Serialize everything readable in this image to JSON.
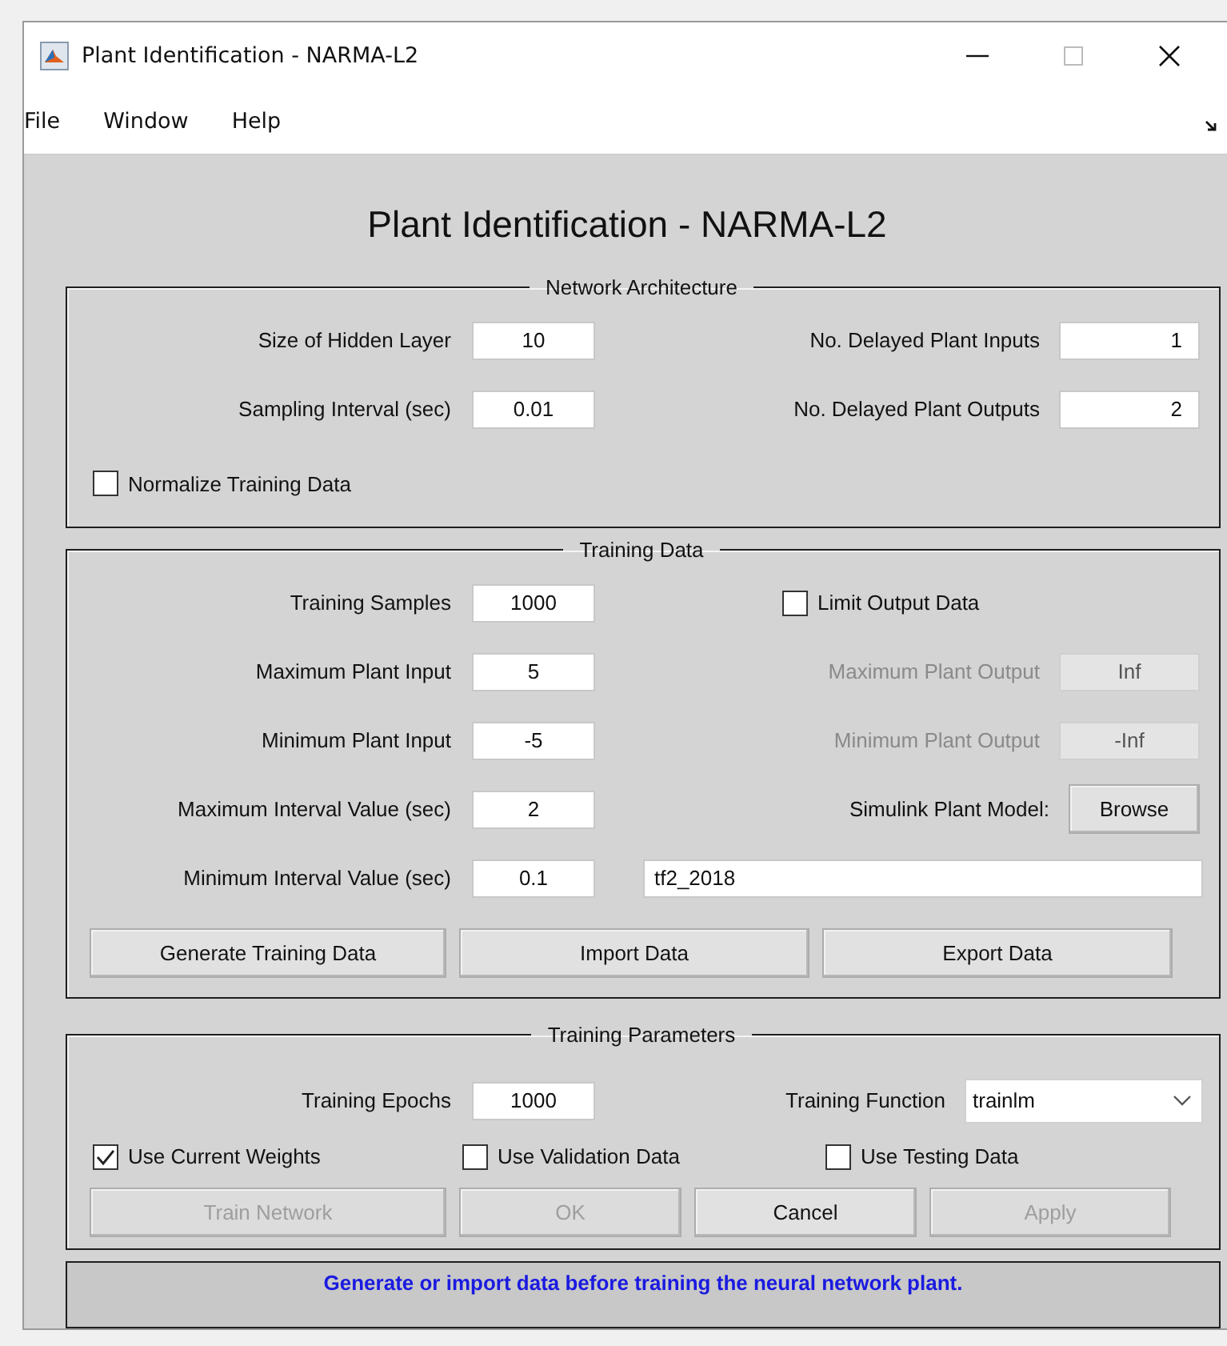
{
  "window": {
    "title": "Plant Identification - NARMA-L2"
  },
  "menu": [
    "File",
    "Window",
    "Help"
  ],
  "heading": "Plant Identification - NARMA-L2",
  "panels": [
    {
      "title": "Network Architecture",
      "rows": [
        {
          "cells": [
            {
              "kind": "field",
              "label": "Size of Hidden Layer",
              "value": "10",
              "disabled": false
            },
            {
              "kind": "field",
              "label": "No. Delayed Plant Inputs",
              "value": "1",
              "disabled": false
            }
          ]
        },
        {
          "cells": [
            {
              "kind": "field",
              "label": "Sampling Interval (sec)",
              "value": "0.01",
              "disabled": false
            },
            {
              "kind": "field",
              "label": "No. Delayed Plant Outputs",
              "value": "2",
              "disabled": false
            }
          ]
        },
        {
          "cells": [
            {
              "kind": "checkbox",
              "label": "Normalize Training Data",
              "checked": false
            }
          ]
        }
      ]
    },
    {
      "title": "Training Data",
      "rows": [
        {
          "cells": [
            {
              "kind": "field",
              "label": "Training Samples",
              "value": "1000",
              "disabled": false
            },
            {
              "kind": "checkbox",
              "label": "Limit Output Data",
              "checked": false
            }
          ]
        },
        {
          "cells": [
            {
              "kind": "field",
              "label": "Maximum Plant Input",
              "value": "5",
              "disabled": false
            },
            {
              "kind": "field",
              "label": "Maximum Plant Output",
              "value": "Inf",
              "disabled": true
            }
          ]
        },
        {
          "cells": [
            {
              "kind": "field",
              "label": "Minimum Plant Input",
              "value": "-5",
              "disabled": false
            },
            {
              "kind": "field",
              "label": "Minimum Plant Output",
              "value": "-Inf",
              "disabled": true
            }
          ]
        },
        {
          "cells": [
            {
              "kind": "field",
              "label": "Maximum Interval Value (sec)",
              "value": "2",
              "disabled": false
            },
            {
              "kind": "browse",
              "label": "Simulink Plant Model:",
              "button": "Browse"
            }
          ]
        },
        {
          "cells": [
            {
              "kind": "field",
              "label": "Minimum Interval Value (sec)",
              "value": "0.1",
              "disabled": false
            },
            {
              "kind": "text",
              "value": "tf2_2018"
            }
          ]
        },
        {
          "buttons": [
            {
              "label": "Generate Training Data",
              "disabled": false
            },
            {
              "label": "Import Data",
              "disabled": false
            },
            {
              "label": "Export Data",
              "disabled": false
            }
          ]
        }
      ]
    },
    {
      "title": "Training Parameters",
      "rows": [
        {
          "cells": [
            {
              "kind": "field",
              "label": "Training Epochs",
              "value": "1000",
              "disabled": false
            },
            {
              "kind": "dropdown",
              "label": "Training Function",
              "value": "trainlm"
            }
          ]
        },
        {
          "checks": [
            {
              "label": "Use Current Weights",
              "checked": true
            },
            {
              "label": "Use Validation Data",
              "checked": false
            },
            {
              "label": "Use Testing Data",
              "checked": false
            }
          ]
        },
        {
          "buttons": [
            {
              "label": "Train Network",
              "disabled": true
            },
            {
              "label": "OK",
              "disabled": true
            },
            {
              "label": "Cancel",
              "disabled": false
            },
            {
              "label": "Apply",
              "disabled": true
            }
          ]
        }
      ]
    }
  ],
  "status": "Generate or import data before training the neural network plant."
}
